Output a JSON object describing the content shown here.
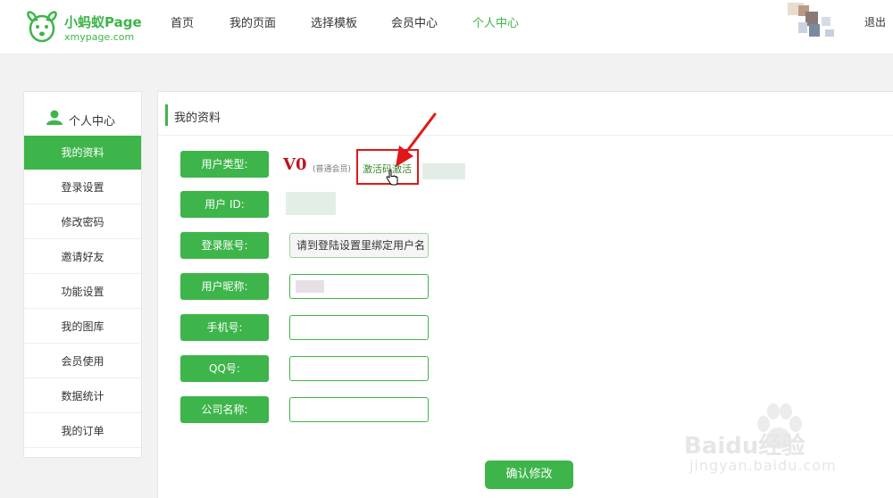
{
  "brand": {
    "name": "小蚂蚁Page",
    "url": "xmypage.com",
    "color": "#3db54a"
  },
  "nav": {
    "items": [
      {
        "label": "首页",
        "active": false
      },
      {
        "label": "我的页面",
        "active": false
      },
      {
        "label": "选择模板",
        "active": false
      },
      {
        "label": "会员中心",
        "active": false
      },
      {
        "label": "个人中心",
        "active": true
      }
    ],
    "logout": "退出"
  },
  "sidebar": {
    "title": "个人中心",
    "icon": "user-icon",
    "items": [
      {
        "label": "我的资料",
        "active": true
      },
      {
        "label": "登录设置",
        "active": false
      },
      {
        "label": "修改密码",
        "active": false
      },
      {
        "label": "邀请好友",
        "active": false
      },
      {
        "label": "功能设置",
        "active": false
      },
      {
        "label": "我的图库",
        "active": false
      },
      {
        "label": "会员使用",
        "active": false
      },
      {
        "label": "数据统计",
        "active": false
      },
      {
        "label": "我的订单",
        "active": false
      }
    ]
  },
  "profile": {
    "title": "我的资料",
    "user_type": {
      "label": "用户类型:",
      "level": "V0",
      "level_name": "(普通会员)",
      "activate_link": "激活码激活"
    },
    "user_id": {
      "label": "用户 ID:"
    },
    "account": {
      "label": "登录账号:",
      "value": "请到登陆设置里绑定用户名"
    },
    "nickname": {
      "label": "用户昵称:",
      "value": ""
    },
    "phone": {
      "label": "手机号:",
      "value": ""
    },
    "qq": {
      "label": "QQ号:",
      "value": ""
    },
    "company": {
      "label": "公司名称:",
      "value": ""
    },
    "submit": "确认修改"
  },
  "watermark": {
    "brand": "Baidu经验",
    "url": "jingyan.baidu.com"
  },
  "colors": {
    "accent": "#3db54a",
    "highlight_red": "#e01818",
    "vip_red": "#c0161e"
  }
}
